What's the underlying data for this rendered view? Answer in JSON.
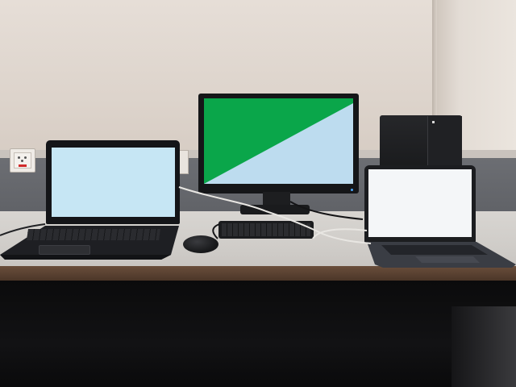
{
  "scene": {
    "objects": [
      "wall-outlet",
      "desktop-monitor",
      "left-laptop",
      "right-laptop",
      "keyboard",
      "mouse",
      "pc-tower",
      "desk"
    ],
    "colors": {
      "monitor_green": "#0aa64a",
      "monitor_light": "#bddcef",
      "left_laptop_screen": "#c6e6f4",
      "right_laptop_screen": "#f4f6f8",
      "desk_top": "#d3d0cc",
      "desk_edge": "#5a4030",
      "wall": "#e0d8d1"
    }
  }
}
